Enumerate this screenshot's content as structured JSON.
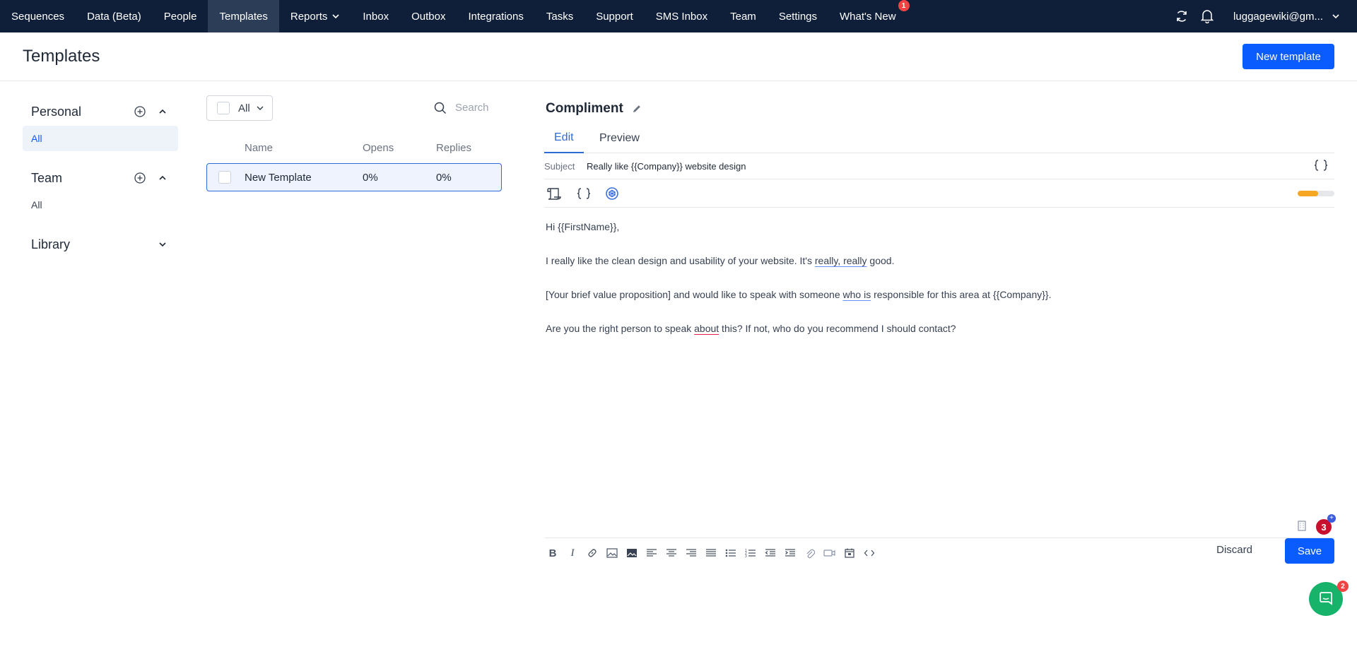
{
  "nav": {
    "items": [
      {
        "label": "Sequences"
      },
      {
        "label": "Data (Beta)"
      },
      {
        "label": "People"
      },
      {
        "label": "Templates"
      },
      {
        "label": "Reports"
      },
      {
        "label": "Inbox"
      },
      {
        "label": "Outbox"
      },
      {
        "label": "Integrations"
      },
      {
        "label": "Tasks"
      },
      {
        "label": "Support"
      },
      {
        "label": "SMS Inbox"
      },
      {
        "label": "Team"
      },
      {
        "label": "Settings"
      },
      {
        "label": "What's New",
        "badge": "1"
      }
    ],
    "active": "Templates",
    "user": "luggagewiki@gm..."
  },
  "header": {
    "title": "Templates",
    "new_button": "New template"
  },
  "sidebar": {
    "personal": {
      "label": "Personal",
      "items": [
        {
          "label": "All"
        }
      ]
    },
    "team": {
      "label": "Team",
      "items": [
        {
          "label": "All"
        }
      ]
    },
    "library": {
      "label": "Library"
    }
  },
  "list": {
    "filter": "All",
    "search_placeholder": "Search",
    "columns": [
      "Name",
      "Opens",
      "Replies"
    ],
    "rows": [
      {
        "name": "New Template",
        "opens": "0%",
        "replies": "0%"
      }
    ]
  },
  "editor": {
    "template_name": "Compliment",
    "tabs": [
      "Edit",
      "Preview"
    ],
    "active_tab": "Edit",
    "subject_label": "Subject",
    "subject_value": "Really like {{Company}} website design",
    "progress_fraction": 0.55,
    "body": {
      "line1": "Hi {{FirstName}},",
      "line2_a": "I really like the clean design and usability of your website. It's ",
      "line2_b": "really, really",
      "line2_c": " good.",
      "line3_a": "[Your brief value proposition] and would like to speak with someone ",
      "line3_b": "who is",
      "line3_c": " responsible for this area at {{Company}}.",
      "line4_a": "Are you the right person to speak ",
      "line4_b": "about",
      "line4_c": " this? If not, who do you recommend I should contact?"
    },
    "grammar_count": "3",
    "discard": "Discard",
    "save": "Save"
  },
  "chat": {
    "badge": "2"
  },
  "colors": {
    "nav_bg": "#0f1f3a",
    "primary": "#0a5cff",
    "accent_orange": "#f5a623",
    "chat_green": "#18b36b"
  }
}
